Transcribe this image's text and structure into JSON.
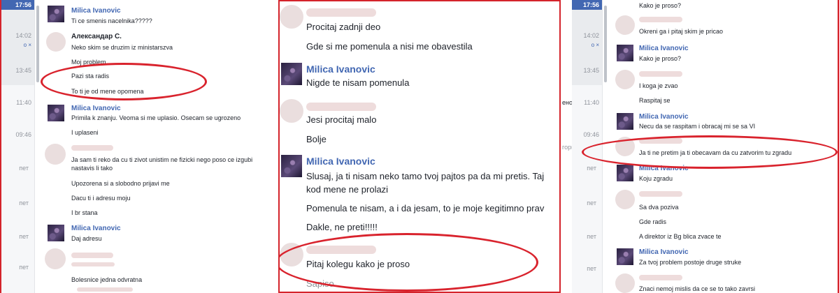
{
  "left": {
    "header_time": "17:56",
    "timestamps": [
      "14:02",
      "13:45",
      "11:40",
      "09:46",
      "пет",
      "пет",
      "пет",
      "пет",
      "пет"
    ],
    "ts_sub": "o  ×",
    "cut_text": "",
    "messages": [
      {
        "name": "Milica Ivanovic",
        "lines": [
          "Ti ce smenis nacelnika?????"
        ]
      },
      {
        "name": "Александар С.",
        "lines": [
          "Neko skim se druzim iz ministarszva",
          "Moj problem",
          "Pazi sta radis",
          "To ti je od mene opomena"
        ]
      },
      {
        "name": "Milica Ivanovic",
        "lines": [
          "Primila k znanju. Veoma si me uplasio. Osecam se ugrozeno",
          "I uplaseni"
        ]
      },
      {
        "name": "",
        "lines": [
          "Ja sam ti reko da cu ti zivot unistim ne fizicki nego poso ce izgubi",
          "nastavis li tako",
          "Upozorena si a slobodno prijavi me",
          "Dacu ti i adresu moju",
          "I br stana"
        ]
      },
      {
        "name": "Milica Ivanovic",
        "lines": [
          "Daj adresu"
        ]
      },
      {
        "name": "",
        "lines": [
          "Bolesnice jedna odvratna"
        ]
      }
    ]
  },
  "middle": {
    "messages": [
      {
        "name": "",
        "lines": [
          "Procitaj zadnji deo",
          "Gde si me pomenula a nisi me obavestila"
        ]
      },
      {
        "name": "Milica Ivanovic",
        "lines": [
          "Nigde te nisam pomenula"
        ]
      },
      {
        "name": "",
        "lines": [
          "Jesi procitaj malo",
          "Bolje"
        ]
      },
      {
        "name": "Milica Ivanovic",
        "lines": [
          "Slusaj, ja ti nisam neko tamo tvoj pajtos pa da mi pretis. Taj",
          "kod mene ne prolazi",
          "Pomenula te nisam, a i da jesam, to je moje kegitimno prav",
          "Dakle, ne preti!!!!!"
        ]
      },
      {
        "name": "",
        "lines": [
          "Pitaj kolegu kako je proso",
          "Sapiso"
        ]
      }
    ]
  },
  "right": {
    "header_time": "17:56",
    "timestamps": [
      "14:02",
      "13:45",
      "11:40",
      "09:46",
      "пет",
      "пет",
      "пет",
      "пет",
      "пет"
    ],
    "ts_sub": "o  ×",
    "cut_text_1": "ено",
    "cut_text_2": "горп",
    "messages": [
      {
        "name": "",
        "lines": [
          "Kako je proso?"
        ]
      },
      {
        "name": "",
        "lines": [
          "Okreni ga i pitaj skim je pricao"
        ]
      },
      {
        "name": "Milica Ivanovic",
        "lines": [
          "Kako je proso?"
        ]
      },
      {
        "name": "",
        "lines": [
          "I koga je zvao",
          "Raspitaj se"
        ]
      },
      {
        "name": "Milica Ivanovic",
        "lines": [
          "Necu da se raspitam i obracaj mi se sa VI"
        ]
      },
      {
        "name": "",
        "lines": [
          "Ja ti ne pretim ja ti obecavam da cu zatvorim tu zgradu"
        ]
      },
      {
        "name": "Milica Ivanovic",
        "lines": [
          "Koju zgradu"
        ]
      },
      {
        "name": "",
        "lines": [
          "Sa  dva poziva",
          "Gde radis",
          "A direktor iz Bg blica zvace te"
        ]
      },
      {
        "name": "Milica Ivanovic",
        "lines": [
          "Za tvoj problem postoje druge struke"
        ]
      },
      {
        "name": "",
        "lines": [
          "Znaci nemoj mislis da ce se to tako zavrsi"
        ]
      }
    ]
  },
  "colors": {
    "accent": "#4267b2",
    "highlight": "#d9232d"
  }
}
